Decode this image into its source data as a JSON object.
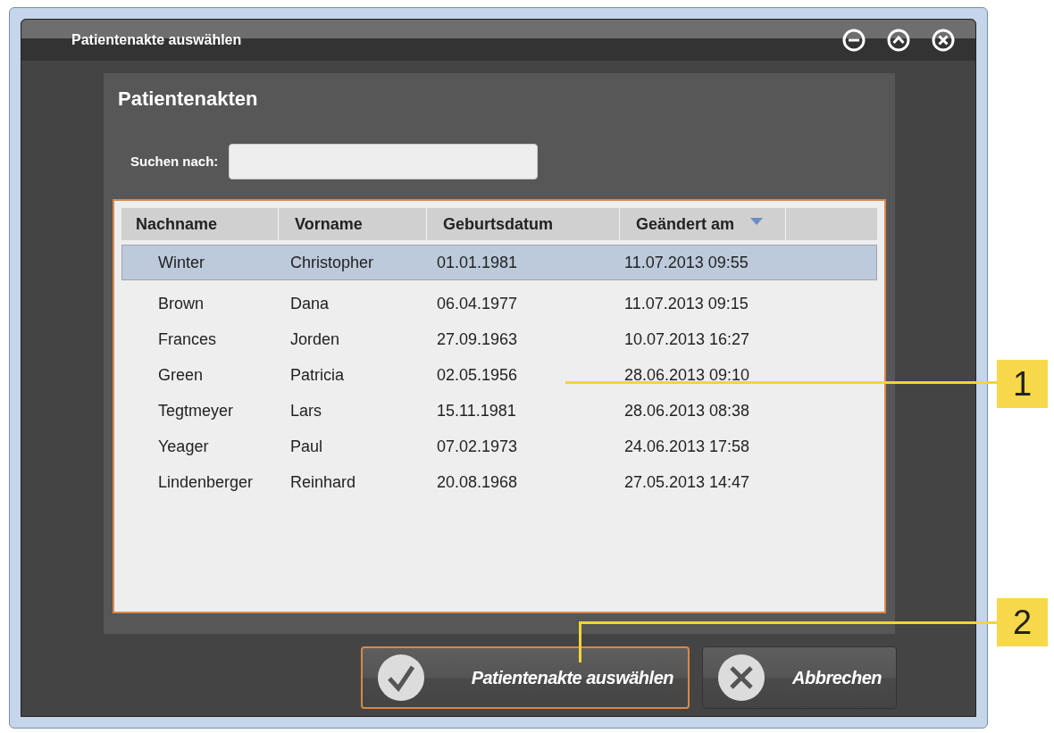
{
  "window": {
    "title": "Patientenakte auswählen",
    "controls": [
      {
        "kind": "minimize"
      },
      {
        "kind": "maximize"
      },
      {
        "kind": "close"
      }
    ]
  },
  "panel": {
    "title": "Patientenakten",
    "search": {
      "label": "Suchen nach:"
    }
  },
  "table": {
    "columns": [
      {
        "label": "Nachname",
        "sorted": false
      },
      {
        "label": "Vorname",
        "sorted": false
      },
      {
        "label": "Geburtsdatum",
        "sorted": false
      },
      {
        "label": "Geändert am",
        "sorted": true
      }
    ],
    "rows": [
      {
        "cells": [
          "Winter",
          "Christopher",
          "01.01.1981",
          "11.07.2013 09:55"
        ],
        "selected": true
      },
      {
        "cells": [
          "Brown",
          "Dana",
          "06.04.1977",
          "11.07.2013 09:15"
        ],
        "selected": false
      },
      {
        "cells": [
          "Frances",
          "Jorden",
          "27.09.1963",
          "10.07.2013 16:27"
        ],
        "selected": false
      },
      {
        "cells": [
          "Green",
          "Patricia",
          "02.05.1956",
          "28.06.2013 09:10"
        ],
        "selected": false
      },
      {
        "cells": [
          "Tegtmeyer",
          "Lars",
          "15.11.1981",
          "28.06.2013 08:38"
        ],
        "selected": false
      },
      {
        "cells": [
          "Yeager",
          "Paul",
          "07.02.1973",
          "24.06.2013 17:58"
        ],
        "selected": false
      },
      {
        "cells": [
          "Lindenberger",
          "Reinhard",
          "20.08.1968",
          "27.05.2013 14:47"
        ],
        "selected": false
      }
    ]
  },
  "buttons": [
    {
      "label": "Patientenakte auswählen",
      "kind": "confirm",
      "focused": true
    },
    {
      "label": "Abbrechen",
      "kind": "cancel",
      "focused": false
    }
  ],
  "callouts": [
    {
      "label": "1"
    },
    {
      "label": "2"
    }
  ]
}
